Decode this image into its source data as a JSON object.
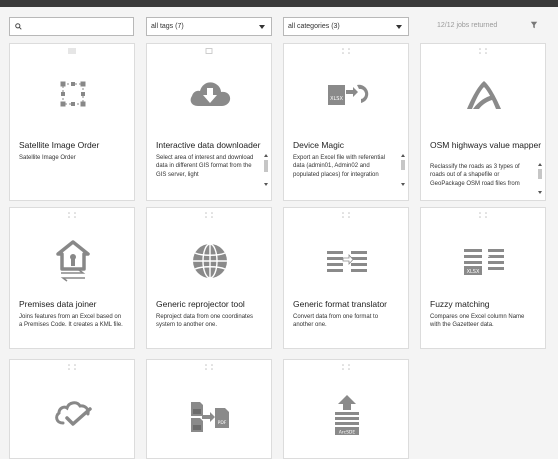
{
  "search": {
    "value": "",
    "placeholder": ""
  },
  "filters": {
    "tags_selected": "all tags (7)",
    "categories_selected": "all categories (3)"
  },
  "jobs_returned": "12/12 jobs returned",
  "colors": {
    "icon_gray": "#8a8a8a",
    "border": "#dcdcdc",
    "topbar": "#3a3a3a"
  },
  "cards": [
    {
      "title": "Satellite Image Order",
      "description": "Satellite Image Order",
      "icon": "selection-square-icon"
    },
    {
      "title": "Interactive data downloader",
      "description": "Select area of interest and download data in different GIS format from the GIS server, light",
      "icon": "cloud-download-icon"
    },
    {
      "title": "Device Magic",
      "description": "Export an Excel file with referential data (admin01, Admin02 and populated places) for integration",
      "icon": "excel-convert-icon"
    },
    {
      "title": "OSM highways value mapper",
      "description": "Reclassify the roads as 3 types of roads out of a shapefile or GeoPackage OSM road files from",
      "icon": "highway-road-icon"
    },
    {
      "title": "Premises data joiner",
      "description": "Joins features from an Excel based on a Premises Code. It creates a KML file.",
      "icon": "house-exchange-icon"
    },
    {
      "title": "Generic reprojector tool",
      "description": "Reproject data from one coordinates system to another one.",
      "icon": "globe-icon"
    },
    {
      "title": "Generic format translator",
      "description": "Convert data from one format to another one.",
      "icon": "format-exchange-icon"
    },
    {
      "title": "Fuzzy matching",
      "description": "Compares one Excel column Name with the Gazetteer data.",
      "icon": "xlsx-match-icon"
    },
    {
      "title": "",
      "description": "",
      "icon": "cloud-check-icon"
    },
    {
      "title": "",
      "description": "",
      "icon": "pdf-convert-icon"
    },
    {
      "title": "",
      "description": "",
      "icon": "arcsde-upload-icon",
      "icon_label": "ArcSDE"
    }
  ],
  "icon_labels": {
    "device_magic": "XLSX",
    "fuzzy": "XLSX",
    "pdf_a": "PDF",
    "pdf_b": "PDF",
    "arcsde": "ArcSDE"
  }
}
